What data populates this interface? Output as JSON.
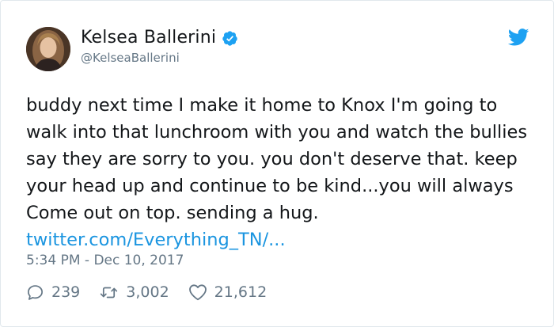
{
  "author": {
    "name": "Kelsea Ballerini",
    "handle": "@KelseaBallerini",
    "verified": true
  },
  "tweet": {
    "text": "buddy next time I make it home to Knox I'm going to walk into that lunchroom with you and watch the bullies say they are sorry to you. you don't deserve that. keep your head up and continue to be kind...you will always Come out on top. sending a hug.",
    "link": "twitter.com/Everything_TN/...",
    "timestamp": "5:34 PM - Dec 10, 2017"
  },
  "stats": {
    "replies": "239",
    "retweets": "3,002",
    "likes": "21,612"
  },
  "icons": {
    "brand": "twitter-bird-icon",
    "verified": "verified-badge-icon",
    "reply": "reply-icon",
    "retweet": "retweet-icon",
    "like": "heart-icon"
  },
  "colors": {
    "brand_blue": "#1da1f2",
    "link_blue": "#1b95e0",
    "muted": "#657786",
    "text": "#14171a"
  }
}
